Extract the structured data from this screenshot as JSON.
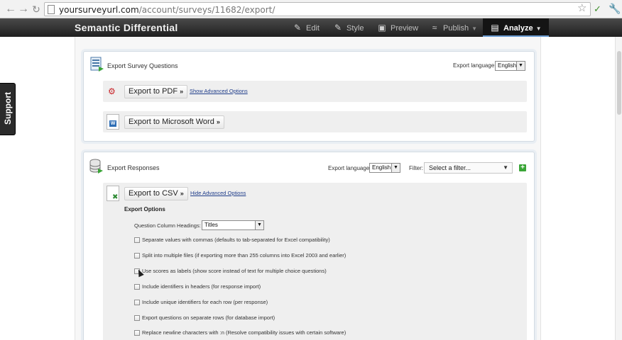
{
  "browser": {
    "url_host": "yoursurveyurl.com",
    "url_path": "/account/surveys/11682/export/"
  },
  "header": {
    "survey_title": "Semantic Differential",
    "menu": [
      {
        "label": "Edit",
        "icon": "pencil-icon"
      },
      {
        "label": "Style",
        "icon": "brush-icon"
      },
      {
        "label": "Preview",
        "icon": "monitor-icon"
      },
      {
        "label": "Publish",
        "icon": "wifi-icon"
      },
      {
        "label": "Analyze",
        "icon": "chart-icon"
      }
    ]
  },
  "support_label": "Support",
  "export_questions": {
    "title": "Export Survey Questions",
    "language_label": "Export language:",
    "language_value": "English",
    "pdf_button": "Export to PDF",
    "pdf_link": "Show Advanced Options",
    "word_button": "Export to Microsoft Word"
  },
  "export_responses": {
    "title": "Export Responses",
    "language_label": "Export language:",
    "language_value": "English",
    "filter_label": "Filter:",
    "filter_value": "Select a filter...",
    "csv_button": "Export to CSV",
    "csv_link": "Hide Advanced Options",
    "options_title": "Export Options",
    "column_headings_label": "Question Column Headings:",
    "column_headings_value": "Titles",
    "options": [
      "Separate values with commas (defaults to tab-separated for Excel compatibility)",
      "Split into multiple files (if exporting more than 255 columns into Excel 2003 and earlier)",
      "Use scores as labels (show score instead of text for multiple choice questions)",
      "Include identifiers in headers (for response import)",
      "Include unique identifiers for each row (per response)",
      "Export questions on separate rows (for database import)",
      "Replace newline characters with :n (Resolve compatibility issues with certain software)"
    ]
  },
  "colors": {
    "header_bg": "#1f1f1f",
    "panel_border": "#d3dbe3",
    "link": "#1f3d8a",
    "add_green": "#3aa537"
  }
}
